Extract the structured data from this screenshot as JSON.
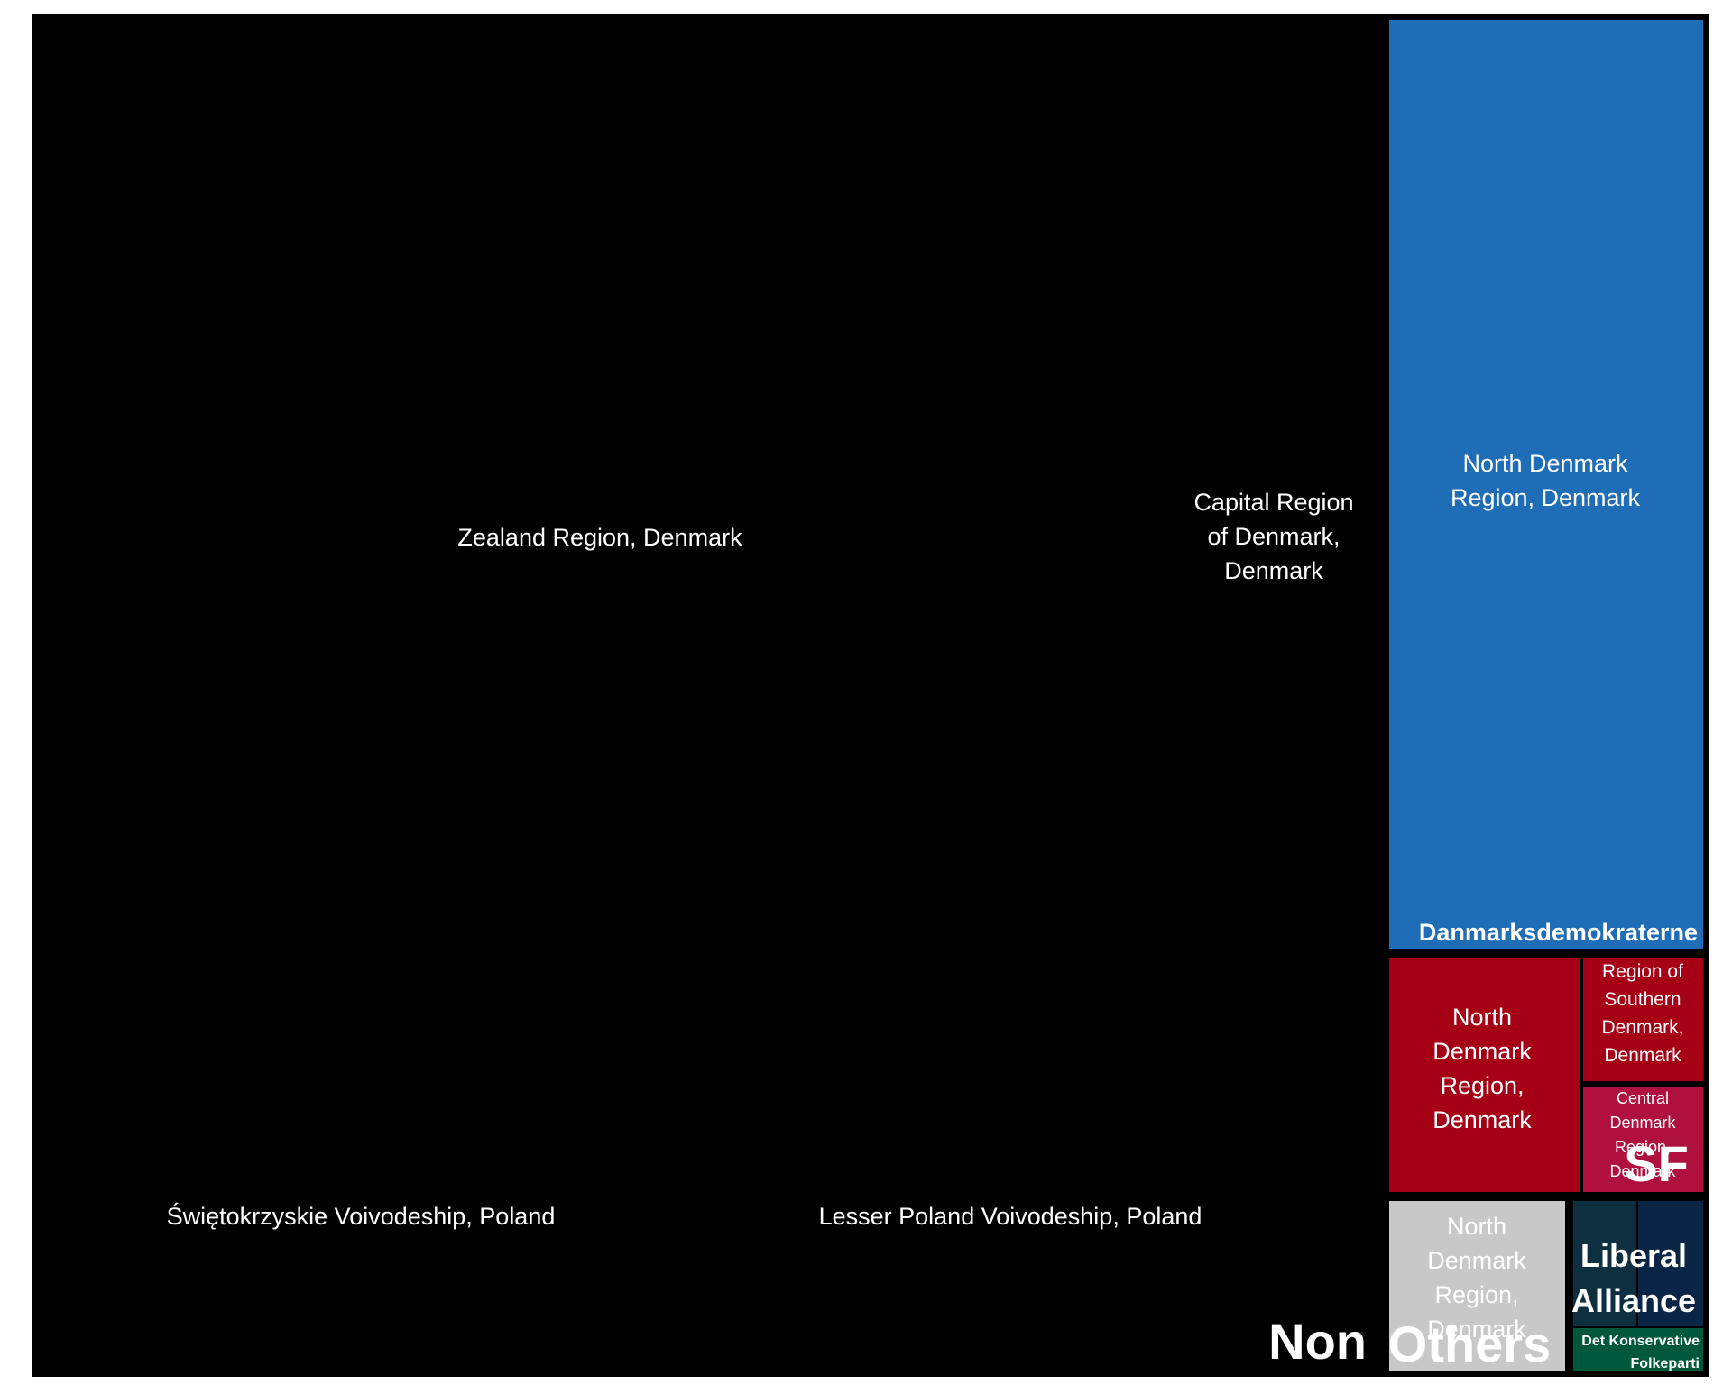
{
  "chart_data": {
    "type": "treemap",
    "groups": [
      {
        "name": "Non",
        "color": "#000000",
        "children": [
          {
            "label": "Zealand Region, Denmark",
            "value": 47
          },
          {
            "label": "Capital Region of Denmark, Denmark",
            "value": 6.9
          },
          {
            "label": "Świętokrzyskie Voivodeship, Poland",
            "value": 7.3
          },
          {
            "label": "Lesser Poland Voivodeship, Poland",
            "value": 6.3
          }
        ]
      },
      {
        "name": "Danmarksdemokraterne",
        "color": "#1f6db6",
        "children": [
          {
            "label": "North Denmark Region, Denmark",
            "value": 15.3
          }
        ]
      },
      {
        "name": "SF",
        "color": "#a50015",
        "children": [
          {
            "label": "North Denmark Region, Denmark",
            "value": 2.5
          },
          {
            "label": "Region of Southern Denmark, Denmark",
            "value": 1.2
          },
          {
            "label": "Central Denmark Region, Denmark",
            "value": 1.3
          }
        ]
      },
      {
        "name": "Others",
        "color": "#c8c8c8",
        "children": [
          {
            "label": "North Denmark Region, Denmark",
            "value": 1.6
          }
        ]
      },
      {
        "name": "Liberal Alliance",
        "color": "#0a2545",
        "children": [
          {
            "label": "",
            "value": 0.5
          },
          {
            "label": "",
            "value": 0.5
          }
        ]
      },
      {
        "name": "Det Konservative Folkeparti",
        "color": "#00583c",
        "children": [
          {
            "label": "",
            "value": 0.35
          }
        ]
      }
    ]
  }
}
